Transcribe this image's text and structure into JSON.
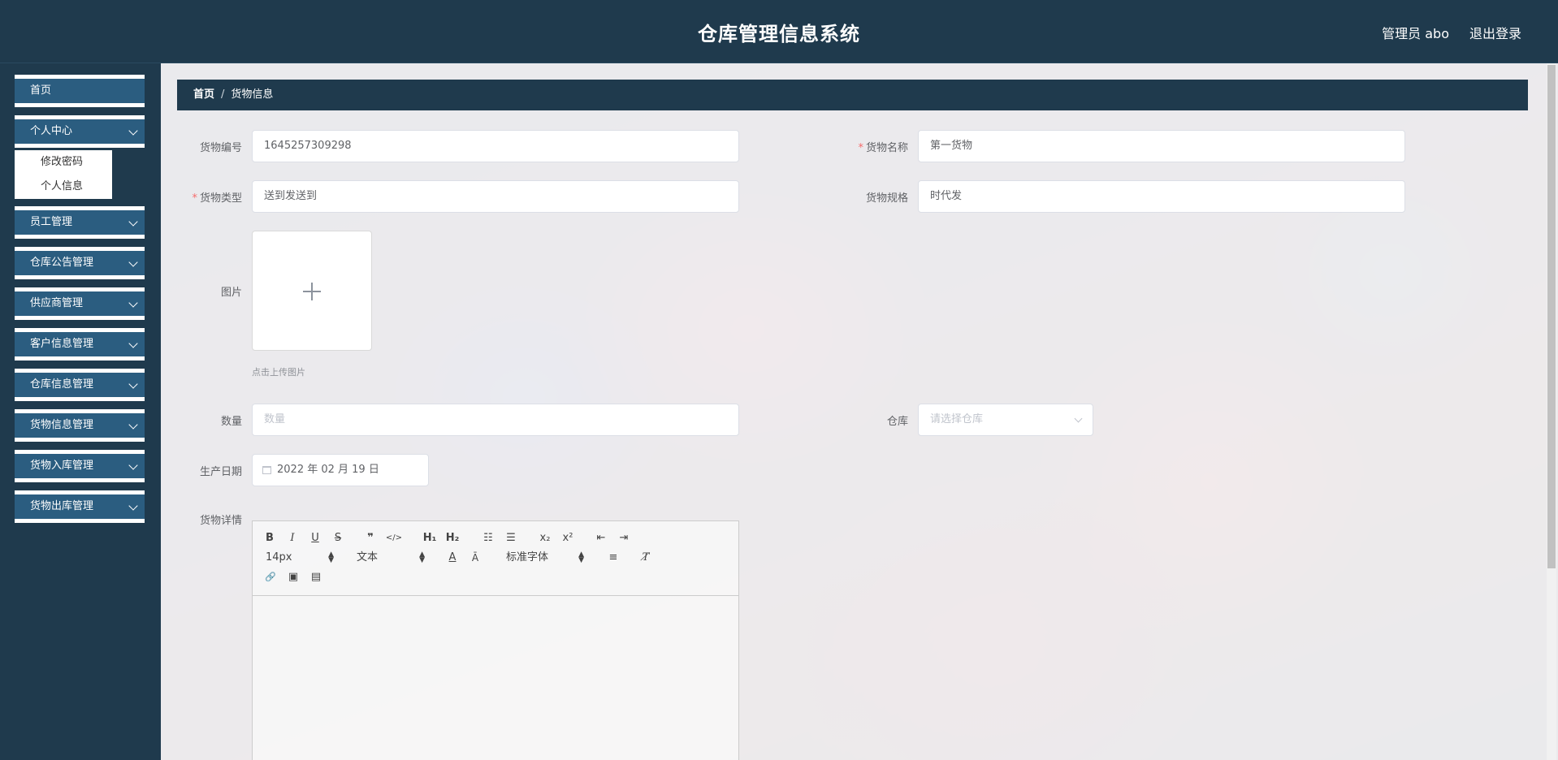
{
  "header": {
    "title": "仓库管理信息系统",
    "user": "管理员 abo",
    "logout": "退出登录"
  },
  "sidebar": {
    "items": [
      {
        "label": "首页"
      },
      {
        "label": "个人中心"
      },
      {
        "label": "员工管理"
      },
      {
        "label": "仓库公告管理"
      },
      {
        "label": "供应商管理"
      },
      {
        "label": "客户信息管理"
      },
      {
        "label": "仓库信息管理"
      },
      {
        "label": "货物信息管理"
      },
      {
        "label": "货物入库管理"
      },
      {
        "label": "货物出库管理"
      }
    ],
    "submenu": [
      {
        "label": "修改密码"
      },
      {
        "label": "个人信息"
      }
    ]
  },
  "breadcrumb": {
    "home": "首页",
    "separator": "/",
    "current": "货物信息"
  },
  "form": {
    "code": {
      "label": "货物编号",
      "value": "1645257309298"
    },
    "name": {
      "label": "货物名称",
      "value": "第一货物",
      "required": "*"
    },
    "type": {
      "label": "货物类型",
      "value": "送到发送到",
      "required": "*"
    },
    "spec": {
      "label": "货物规格",
      "value": "时代发"
    },
    "image": {
      "label": "图片",
      "tip": "点击上传图片"
    },
    "quantity": {
      "label": "数量",
      "placeholder": "数量"
    },
    "warehouse": {
      "label": "仓库",
      "placeholder": "请选择仓库"
    },
    "date": {
      "label": "生产日期",
      "value": "2022 年 02 月 19 日"
    },
    "detail": {
      "label": "货物详情"
    }
  },
  "editor": {
    "buttons": {
      "bold": "B",
      "italic": "I",
      "underline": "U",
      "strike": "S",
      "quote": "❞",
      "code": "</>",
      "h1": "H₁",
      "h2": "H₂",
      "ordered_list": "☷",
      "bullet_list": "☰",
      "sub": "x₂",
      "sup": "x²",
      "outdent": "⇤",
      "indent": "⇥",
      "color": "A",
      "background": "Ā",
      "align": "≡",
      "clean": "T̸",
      "link": "🔗",
      "image": "▣",
      "video": "▤"
    },
    "size": "14px",
    "header": "文本",
    "font": "标准字体"
  },
  "colors": {
    "header_bg": "#1f3a4d",
    "menu_bg": "#2b5d80",
    "required": "#f56c6c"
  }
}
